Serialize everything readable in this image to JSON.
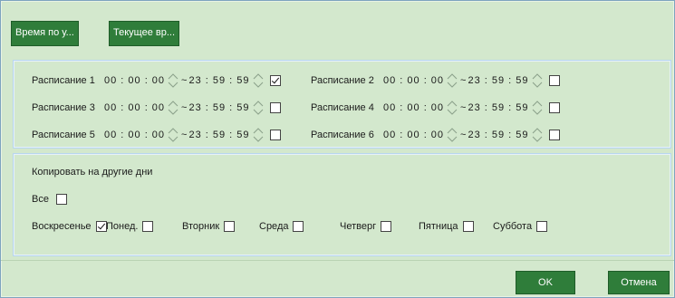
{
  "top_buttons": {
    "sync_time": "Время по у...",
    "current_time": "Текущее вр..."
  },
  "schedules": [
    {
      "label": "Расписание 1",
      "start": "00 : 00 : 00",
      "end": "23 : 59 : 59",
      "enabled": true
    },
    {
      "label": "Расписание 2",
      "start": "00 : 00 : 00",
      "end": "23 : 59 : 59",
      "enabled": false
    },
    {
      "label": "Расписание 3",
      "start": "00 : 00 : 00",
      "end": "23 : 59 : 59",
      "enabled": false
    },
    {
      "label": "Расписание 4",
      "start": "00 : 00 : 00",
      "end": "23 : 59 : 59",
      "enabled": false
    },
    {
      "label": "Расписание 5",
      "start": "00 : 00 : 00",
      "end": "23 : 59 : 59",
      "enabled": false
    },
    {
      "label": "Расписание 6",
      "start": "00 : 00 : 00",
      "end": "23 : 59 : 59",
      "enabled": false
    }
  ],
  "range_separator": "~",
  "copy": {
    "title": "Копировать на другие дни",
    "all_label": "Все",
    "all_checked": false,
    "days": [
      {
        "label": "Воскресенье",
        "checked": true
      },
      {
        "label": "Понед.",
        "checked": false
      },
      {
        "label": "Вторник",
        "checked": false
      },
      {
        "label": "Среда",
        "checked": false
      },
      {
        "label": "Четверг",
        "checked": false
      },
      {
        "label": "Пятница",
        "checked": false
      },
      {
        "label": "Суббота",
        "checked": false
      }
    ]
  },
  "footer": {
    "ok": "OK",
    "cancel": "Отмена"
  }
}
